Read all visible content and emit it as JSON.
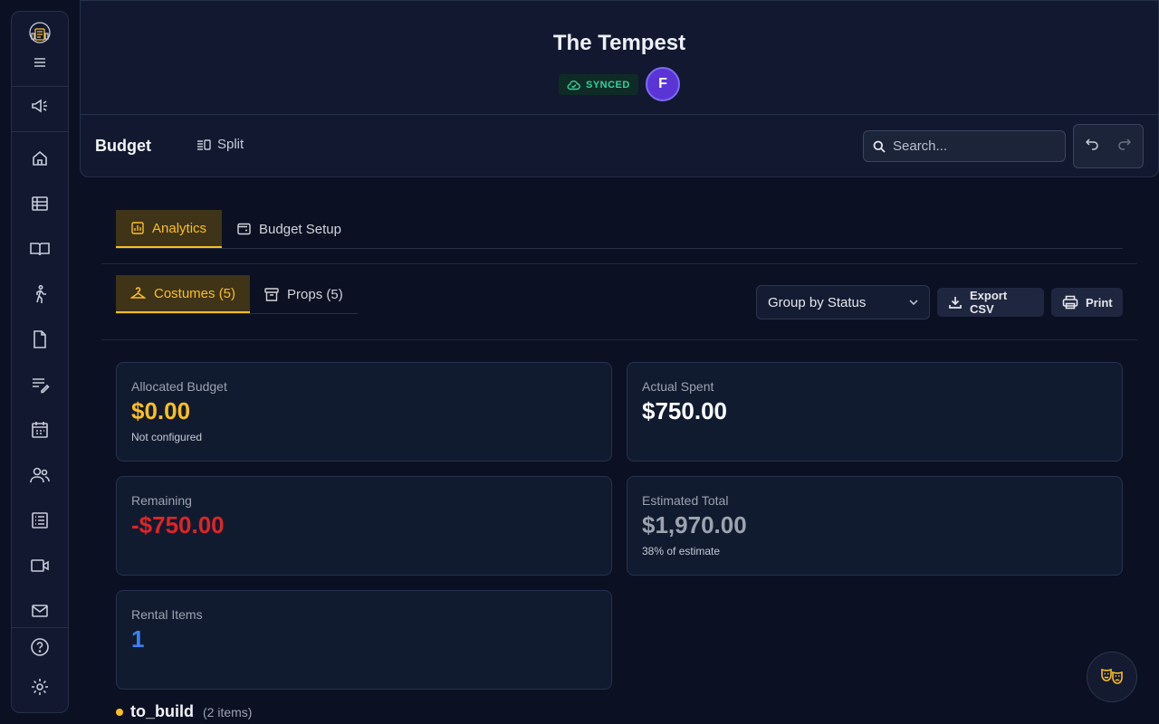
{
  "header": {
    "title": "The Tempest",
    "sync_status": "SYNCED",
    "avatar_initial": "F"
  },
  "toolbar": {
    "page_title": "Budget",
    "split_label": "Split",
    "search_placeholder": "Search..."
  },
  "tabs": [
    {
      "label": "Analytics",
      "active": true
    },
    {
      "label": "Budget Setup",
      "active": false
    }
  ],
  "subtabs": [
    {
      "label": "Costumes (5)",
      "active": true
    },
    {
      "label": "Props (5)",
      "active": false
    }
  ],
  "controls": {
    "group_by": "Group by Status",
    "export_label": "Export CSV",
    "print_label": "Print"
  },
  "cards": {
    "allocated": {
      "label": "Allocated Budget",
      "value": "$0.00",
      "sub": "Not configured"
    },
    "actual": {
      "label": "Actual Spent",
      "value": "$750.00"
    },
    "remaining": {
      "label": "Remaining",
      "value": "-$750.00"
    },
    "estimated": {
      "label": "Estimated Total",
      "value": "$1,970.00",
      "sub": "38% of estimate"
    },
    "rental": {
      "label": "Rental Items",
      "value": "1"
    }
  },
  "group": {
    "name": "to_build",
    "count": "(2 items)"
  },
  "colors": {
    "accent": "#fbbf24",
    "negative": "#dc2626",
    "link": "#3b82f6",
    "synced": "#34d399",
    "avatar": "#5b34d6"
  },
  "sidebar_icons": [
    "logo-icon",
    "menu-icon",
    "megaphone-icon",
    "home-icon",
    "table-icon",
    "book-icon",
    "walk-icon",
    "file-icon",
    "notes-icon",
    "calendar-icon",
    "people-icon",
    "list-icon",
    "video-icon",
    "mail-icon",
    "help-icon",
    "gear-icon"
  ]
}
